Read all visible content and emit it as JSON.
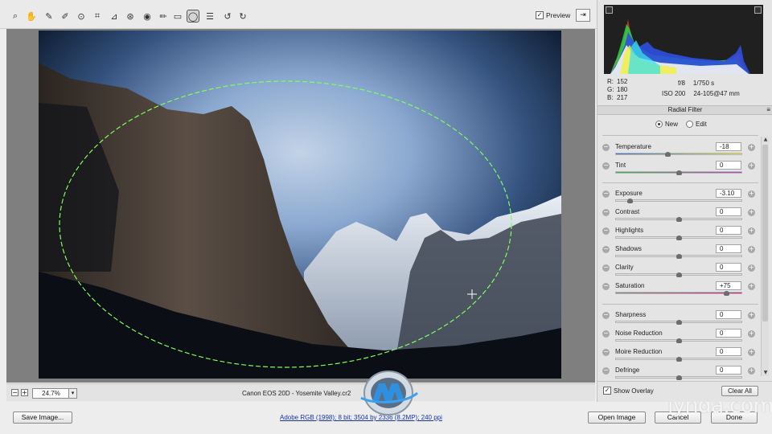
{
  "toolbar": {
    "tools": [
      {
        "name": "zoom-tool-icon",
        "glyph": "⌕"
      },
      {
        "name": "hand-tool-icon",
        "glyph": "✋"
      },
      {
        "name": "white-balance-tool-icon",
        "glyph": "✎"
      },
      {
        "name": "color-sampler-tool-icon",
        "glyph": "✐"
      },
      {
        "name": "targeted-adjustment-tool-icon",
        "glyph": "⊙"
      },
      {
        "name": "crop-tool-icon",
        "glyph": "⌗"
      },
      {
        "name": "straighten-tool-icon",
        "glyph": "⊿"
      },
      {
        "name": "spot-removal-tool-icon",
        "glyph": "⊛"
      },
      {
        "name": "red-eye-tool-icon",
        "glyph": "◉"
      },
      {
        "name": "adjustment-brush-icon",
        "glyph": "✏"
      },
      {
        "name": "graduated-filter-icon",
        "glyph": "▭"
      },
      {
        "name": "radial-filter-icon",
        "glyph": "◯"
      },
      {
        "name": "preferences-icon",
        "glyph": "☰"
      },
      {
        "name": "rotate-left-icon",
        "glyph": "↺"
      },
      {
        "name": "rotate-right-icon",
        "glyph": "↻"
      }
    ],
    "preview_label": "Preview",
    "preview_checked": "✓",
    "fullscreen_glyph": "⇥"
  },
  "status": {
    "zoom_out_glyph": "−",
    "zoom_in_glyph": "+",
    "zoom": "24.7%",
    "zoom_menu_glyph": "▾",
    "filename": "Canon EOS 20D  -  Yosemite Valley.cr2"
  },
  "footer": {
    "save_image": "Save Image...",
    "workflow": "Adobe RGB (1998); 8 bit; 3504 by 2336 (8.2MP); 240 ppi",
    "open_image": "Open Image",
    "cancel": "Cancel",
    "done": "Done"
  },
  "watermark": {
    "lynda": "lynda.com"
  },
  "readout": {
    "r_label": "R:",
    "r": "152",
    "g_label": "G:",
    "g": "180",
    "b_label": "B:",
    "b": "217",
    "aperture": "f/8",
    "shutter": "1/750 s",
    "iso": "ISO 200",
    "lens": "24-105@47 mm"
  },
  "panel": {
    "title": "Radial Filter",
    "menu_glyph": "≡",
    "mode_new": "New",
    "mode_edit": "Edit",
    "show_overlay": "Show Overlay",
    "show_overlay_checked": "✓",
    "clear_all": "Clear All"
  },
  "sliders": [
    {
      "label": "Temperature",
      "value": "-18",
      "min": -100,
      "max": 100,
      "num": -18,
      "track": "temperature"
    },
    {
      "label": "Tint",
      "value": "0",
      "min": -100,
      "max": 100,
      "num": 0,
      "track": "tint"
    },
    {
      "label": "Exposure",
      "value": "-3.10",
      "min": -4,
      "max": 4,
      "num": -3.1,
      "track": "plain"
    },
    {
      "label": "Contrast",
      "value": "0",
      "min": -100,
      "max": 100,
      "num": 0,
      "track": "plain"
    },
    {
      "label": "Highlights",
      "value": "0",
      "min": -100,
      "max": 100,
      "num": 0,
      "track": "plain"
    },
    {
      "label": "Shadows",
      "value": "0",
      "min": -100,
      "max": 100,
      "num": 0,
      "track": "plain"
    },
    {
      "label": "Clarity",
      "value": "0",
      "min": -100,
      "max": 100,
      "num": 0,
      "track": "plain"
    },
    {
      "label": "Saturation",
      "value": "+75",
      "min": -100,
      "max": 100,
      "num": 75,
      "track": "saturation"
    },
    {
      "label": "Sharpness",
      "value": "0",
      "min": -100,
      "max": 100,
      "num": 0,
      "track": "plain"
    },
    {
      "label": "Noise Reduction",
      "value": "0",
      "min": -100,
      "max": 100,
      "num": 0,
      "track": "plain"
    },
    {
      "label": "Moire Reduction",
      "value": "0",
      "min": -100,
      "max": 100,
      "num": 0,
      "track": "plain"
    },
    {
      "label": "Defringe",
      "value": "0",
      "min": -100,
      "max": 100,
      "num": 0,
      "track": "plain"
    }
  ],
  "colors": {
    "overlay_ellipse": "#7dff5a",
    "temperature_track": [
      "#3a6fd8",
      "#e8e23a"
    ],
    "tint_track": [
      "#35b84a",
      "#c43cc8"
    ],
    "saturation_track": [
      "#888888",
      "#d8267f"
    ]
  }
}
